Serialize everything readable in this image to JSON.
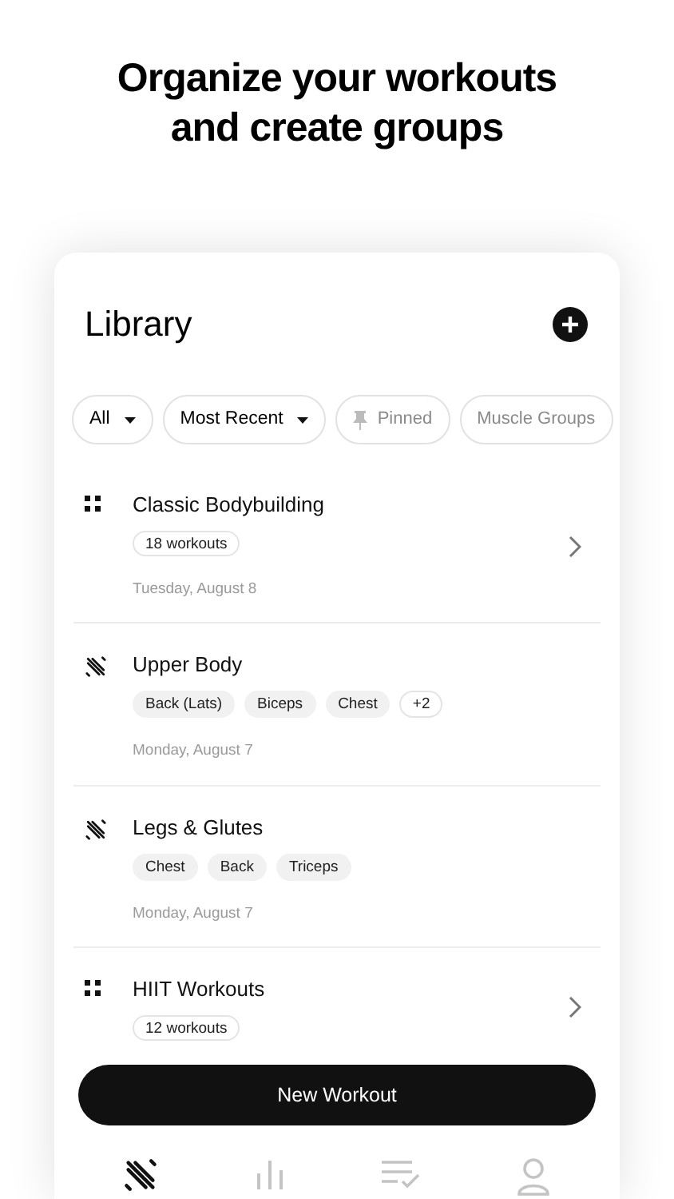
{
  "headline": "Organize your workouts and create groups",
  "library": {
    "title": "Library",
    "filters": [
      {
        "kind": "dropdown",
        "label": "All"
      },
      {
        "kind": "dropdown",
        "label": "Most Recent"
      },
      {
        "kind": "pinned",
        "label": "Pinned"
      },
      {
        "kind": "toggle",
        "label": "Muscle Groups"
      }
    ],
    "items": [
      {
        "kind": "group",
        "title": "Classic Bodybuilding",
        "tags": [
          "18 workouts"
        ],
        "date": "Tuesday, August 8"
      },
      {
        "kind": "workout",
        "title": "Upper Body",
        "tags": [
          "Back (Lats)",
          "Biceps",
          "Chest"
        ],
        "more": "+2",
        "date": "Monday, August 7"
      },
      {
        "kind": "workout",
        "title": "Legs & Glutes",
        "tags": [
          "Chest",
          "Back",
          "Triceps"
        ],
        "date": "Monday, August 7"
      },
      {
        "kind": "group",
        "title": "HIIT Workouts",
        "tags": [
          "12 workouts"
        ]
      }
    ],
    "button": "New Workout",
    "nav": [
      {
        "kind": "workouts",
        "selected": true
      },
      {
        "kind": "stats",
        "selected": false
      },
      {
        "kind": "plans",
        "selected": false
      },
      {
        "kind": "profile",
        "selected": false
      }
    ]
  }
}
